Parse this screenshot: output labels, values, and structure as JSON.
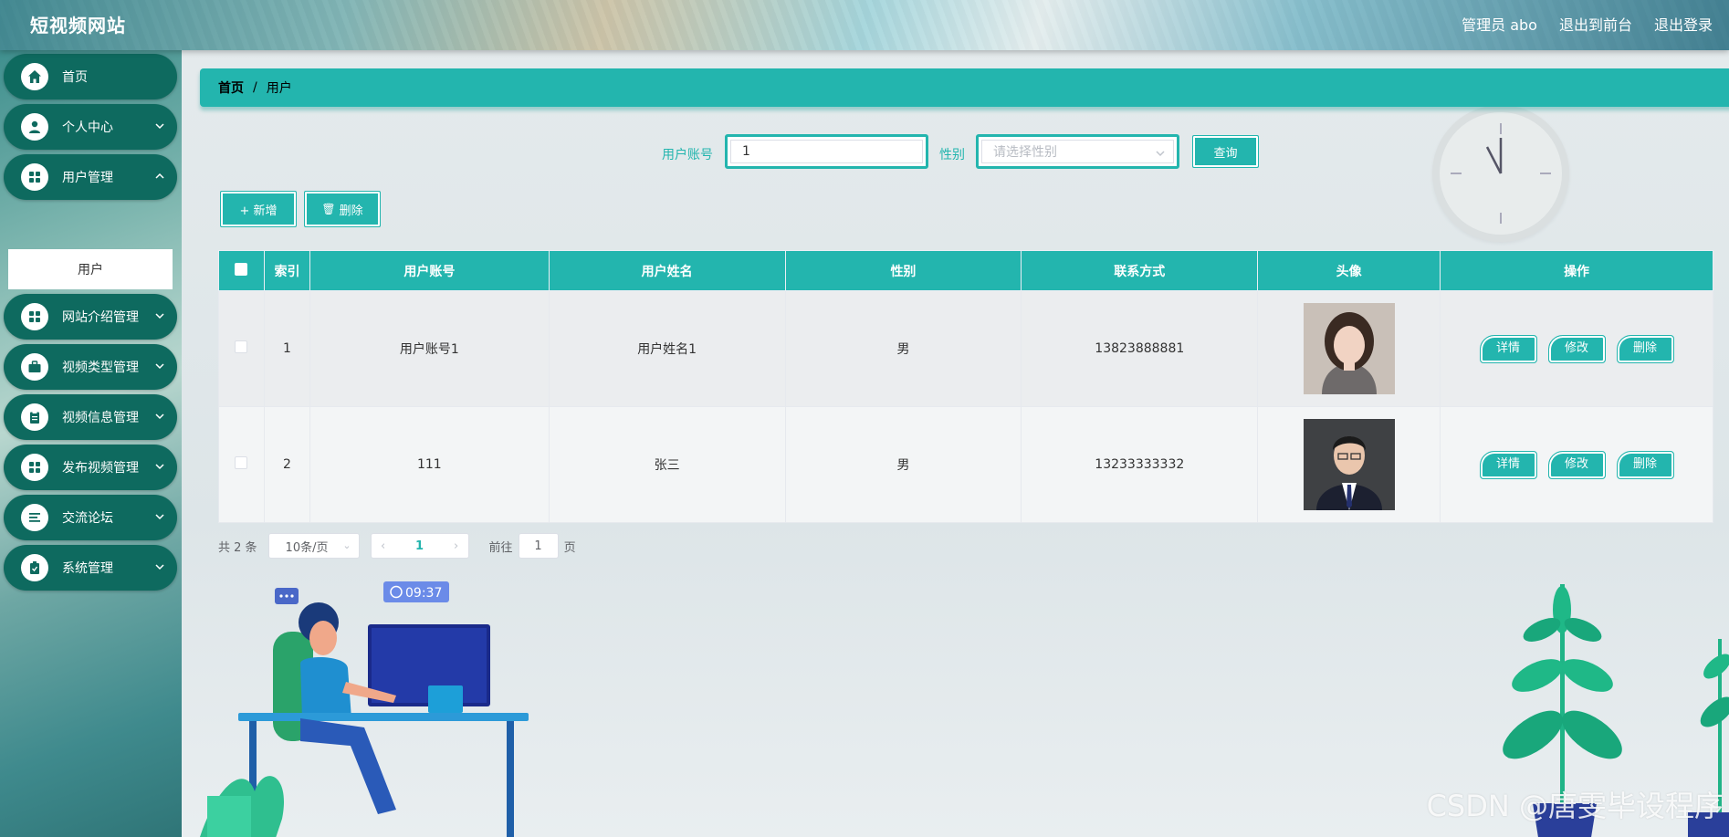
{
  "header": {
    "brand": "短视频网站",
    "admin_label": "管理员 abo",
    "front_link": "退出到前台",
    "logout_link": "退出登录"
  },
  "sidebar": {
    "items": [
      {
        "label": "首页",
        "icon": "home-icon"
      },
      {
        "label": "个人中心",
        "icon": "user-icon"
      },
      {
        "label": "用户管理",
        "icon": "grid-icon"
      },
      {
        "label": "网站介绍管理",
        "icon": "grid-icon"
      },
      {
        "label": "视频类型管理",
        "icon": "briefcase-icon"
      },
      {
        "label": "视频信息管理",
        "icon": "clipboard-icon"
      },
      {
        "label": "发布视频管理",
        "icon": "grid-icon"
      },
      {
        "label": "交流论坛",
        "icon": "list-icon"
      },
      {
        "label": "系统管理",
        "icon": "settings-icon"
      }
    ],
    "sub_item": "用户"
  },
  "breadcrumb": {
    "home": "首页",
    "separator": "/",
    "current": "用户"
  },
  "search": {
    "account_label": "用户账号",
    "account_value": "1",
    "gender_label": "性别",
    "gender_placeholder": "请选择性别",
    "query_button": "查询"
  },
  "actions": {
    "add": "+ 新增",
    "delete": "删除"
  },
  "table": {
    "headers": [
      "索引",
      "用户账号",
      "用户姓名",
      "性别",
      "联系方式",
      "头像",
      "操作"
    ],
    "rows": [
      {
        "index": "1",
        "account": "用户账号1",
        "name": "用户姓名1",
        "gender": "男",
        "phone": "13823888881"
      },
      {
        "index": "2",
        "account": "111",
        "name": "张三",
        "gender": "男",
        "phone": "13233333332"
      }
    ],
    "row_actions": {
      "detail": "详情",
      "edit": "修改",
      "delete": "删除"
    }
  },
  "pagination": {
    "total": "共 2 条",
    "page_size": "10条/页",
    "current_page": "1",
    "goto_label": "前往",
    "goto_value": "1",
    "page_suffix": "页"
  },
  "decor": {
    "clock_time": "09:37",
    "watermark": "CSDN @唐雯毕设程序"
  },
  "colors": {
    "accent": "#23b5ae",
    "sidebar_item": "#0e6a5f"
  }
}
